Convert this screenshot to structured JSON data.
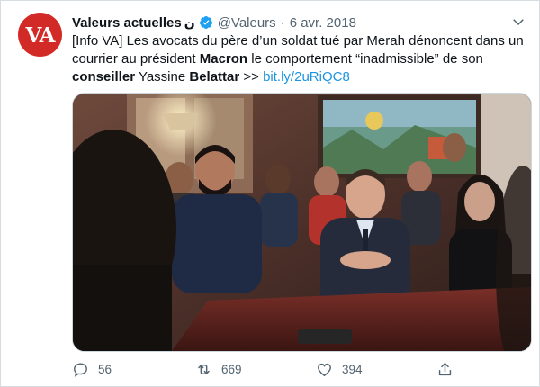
{
  "tweet": {
    "author_name": "Valeurs actuelles",
    "author_suffix": "ن",
    "handle": "@Valeurs",
    "separator": "·",
    "date": "6 avr. 2018",
    "avatar_text": "VA",
    "text_segments": [
      {
        "t": "[Info VA] Les avocats du père d’un soldat tué par Merah dénoncent dans un courrier au président ",
        "s": "plain"
      },
      {
        "t": "Macron",
        "s": "bold"
      },
      {
        "t": " le comportement “inadmissible” de son ",
        "s": "plain"
      },
      {
        "t": "conseiller",
        "s": "bold"
      },
      {
        "t": " Yassine ",
        "s": "plain"
      },
      {
        "t": "Belattar",
        "s": "bold"
      },
      {
        "t": " >> ",
        "s": "plain"
      },
      {
        "t": "bit.ly/2uRiQC8",
        "s": "link"
      }
    ]
  },
  "actions": {
    "reply_count": "56",
    "retweet_count": "669",
    "like_count": "394"
  },
  "icons": {
    "verified": "verified-badge-icon",
    "menu": "chevron-down-icon",
    "reply": "reply-icon",
    "retweet": "retweet-icon",
    "like": "heart-icon",
    "share": "share-icon"
  },
  "colors": {
    "brand_red": "#d22a27",
    "link": "#1b95e0",
    "muted": "#536471",
    "verified": "#1da1f2"
  }
}
